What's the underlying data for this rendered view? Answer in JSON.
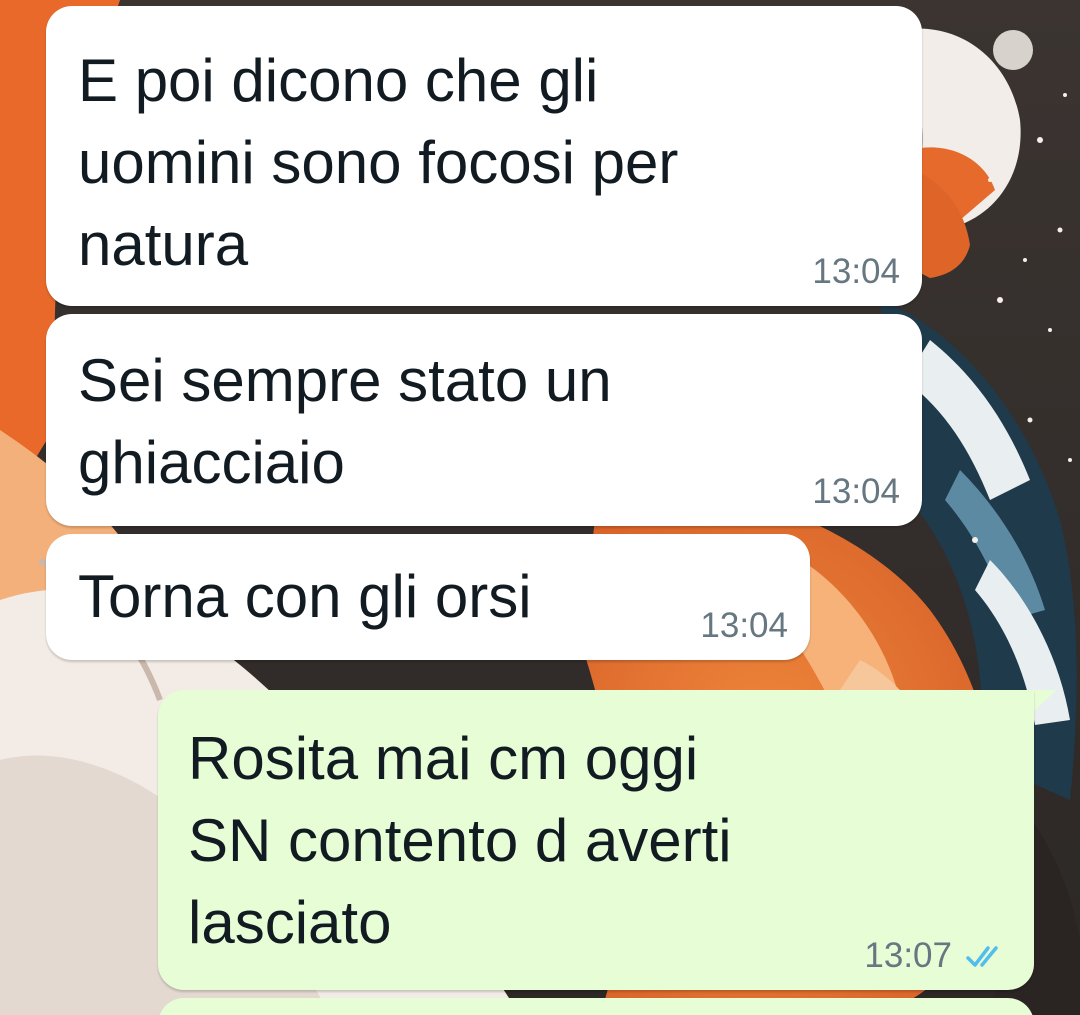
{
  "chat": {
    "wallpaper_icon": "painted-snowboarder-wallpaper",
    "messages": [
      {
        "direction": "incoming",
        "text": "E poi dicono che gli\nuomini sono focosi per\nnatura",
        "time": "13:04"
      },
      {
        "direction": "incoming",
        "text": "Sei sempre stato un\nghiacciaio",
        "time": "13:04"
      },
      {
        "direction": "incoming",
        "text": "Torna con gli orsi",
        "time": "13:04"
      },
      {
        "direction": "outgoing",
        "text": "Rosita mai cm oggi\nSN contento d averti\nlasciato",
        "time": "13:07",
        "status_icon": "double-check-read-icon"
      }
    ]
  },
  "colors": {
    "incoming_bubble": "#ffffff",
    "outgoing_bubble": "#e7fdd6",
    "text": "#111b21",
    "timestamp": "#667781",
    "read_check": "#53bdeb"
  }
}
